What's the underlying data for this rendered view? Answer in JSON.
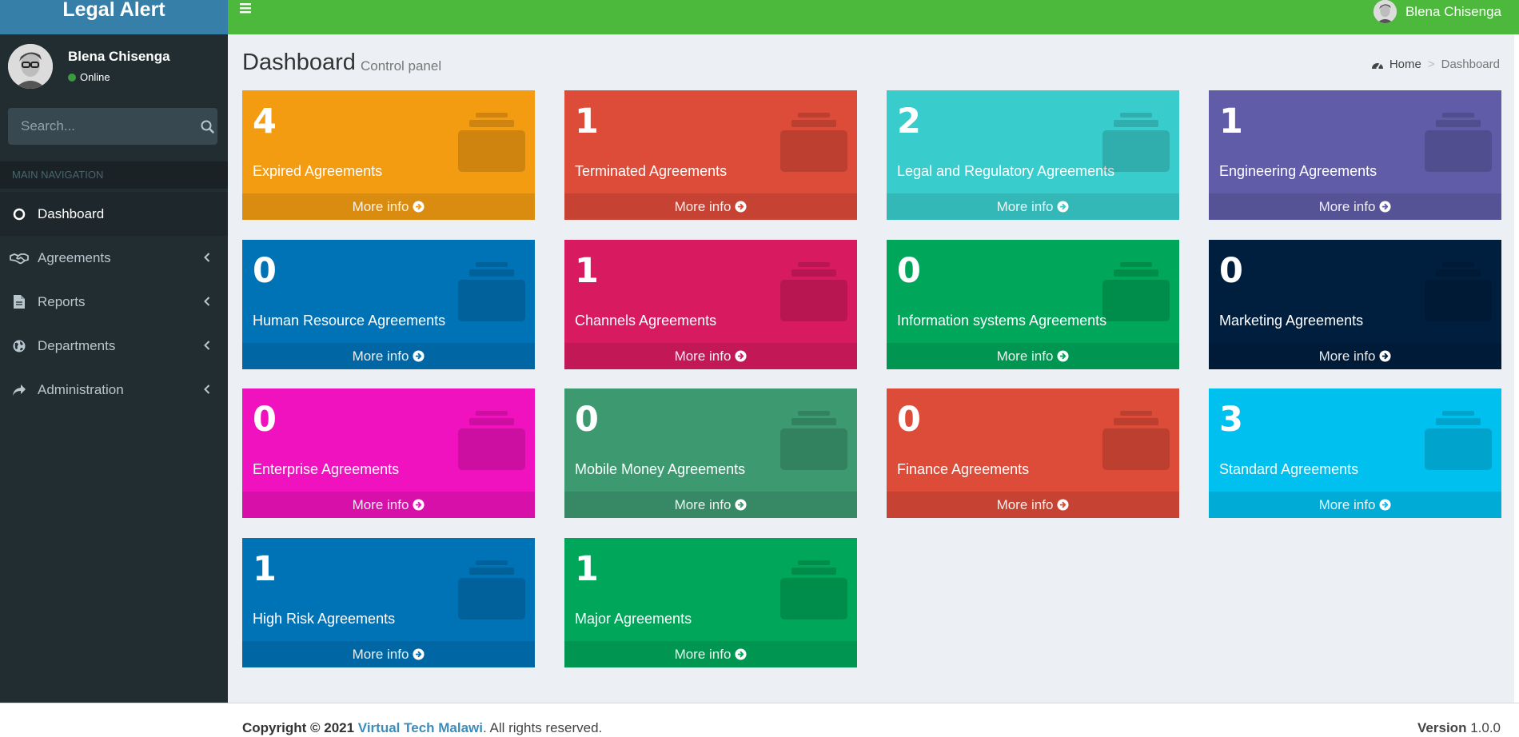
{
  "app": {
    "logo": "Legal Alert"
  },
  "user": {
    "name": "Blena Chisenga",
    "status": "Online"
  },
  "search": {
    "placeholder": "Search..."
  },
  "sidebar": {
    "header": "MAIN NAVIGATION",
    "items": [
      {
        "label": "Dashboard",
        "icon": "circle-icon",
        "active": true
      },
      {
        "label": "Agreements",
        "icon": "handshake-icon"
      },
      {
        "label": "Reports",
        "icon": "file-icon"
      },
      {
        "label": "Departments",
        "icon": "globe-icon"
      },
      {
        "label": "Administration",
        "icon": "share-icon"
      }
    ]
  },
  "page": {
    "title": "Dashboard",
    "subtitle": "Control panel"
  },
  "breadcrumb": {
    "home": "Home",
    "current": "Dashboard"
  },
  "boxes": [
    {
      "count": "4",
      "label": "Expired Agreements",
      "color": "#f39c12",
      "footer": "More info"
    },
    {
      "count": "1",
      "label": "Terminated Agreements",
      "color": "#dd4b39",
      "footer": "More info"
    },
    {
      "count": "2",
      "label": "Legal and Regulatory Agreements",
      "color": "#39cccc",
      "footer": "More info"
    },
    {
      "count": "1",
      "label": "Engineering Agreements",
      "color": "#605ca8",
      "footer": "More info"
    },
    {
      "count": "0",
      "label": "Human Resource Agreements",
      "color": "#0073b7",
      "footer": "More info"
    },
    {
      "count": "1",
      "label": "Channels Agreements",
      "color": "#d81b60",
      "footer": "More info"
    },
    {
      "count": "0",
      "label": "Information systems Agreements",
      "color": "#00a65a",
      "footer": "More info"
    },
    {
      "count": "0",
      "label": "Marketing Agreements",
      "color": "#001f3f",
      "footer": "More info"
    },
    {
      "count": "0",
      "label": "Enterprise Agreements",
      "color": "#f012be",
      "footer": "More info"
    },
    {
      "count": "0",
      "label": "Mobile Money Agreements",
      "color": "#3d9970",
      "footer": "More info"
    },
    {
      "count": "0",
      "label": "Finance Agreements",
      "color": "#dd4b39",
      "footer": "More info"
    },
    {
      "count": "3",
      "label": "Standard Agreements",
      "color": "#00c0ef",
      "footer": "More info"
    },
    {
      "count": "1",
      "label": "High Risk Agreements",
      "color": "#0073b7",
      "footer": "More info"
    },
    {
      "count": "1",
      "label": "Major Agreements",
      "color": "#00a65a",
      "footer": "More info"
    }
  ],
  "footer": {
    "copyright_prefix": "Copyright © 2021",
    "company": "Virtual Tech Malawi",
    "suffix": ". All rights reserved.",
    "version_label": "Version",
    "version": "1.0.0"
  }
}
